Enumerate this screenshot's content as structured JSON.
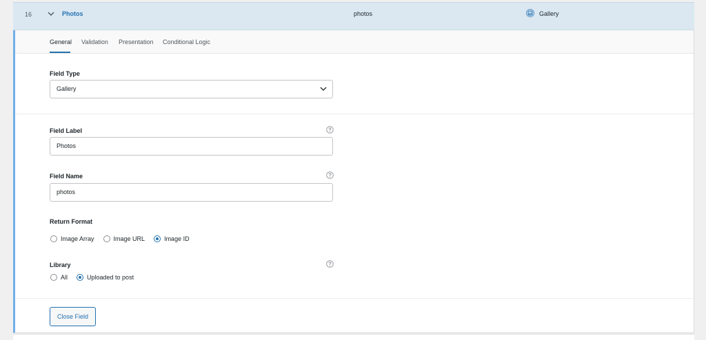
{
  "header": {
    "order": "16",
    "label": "Photos",
    "name": "photos",
    "type": "Gallery",
    "icons": {
      "toggle": "chevron-down-icon",
      "type": "gallery-icon"
    }
  },
  "tabs": [
    {
      "label": "General",
      "active": true
    },
    {
      "label": "Validation",
      "active": false
    },
    {
      "label": "Presentation",
      "active": false
    },
    {
      "label": "Conditional Logic",
      "active": false
    }
  ],
  "field_type": {
    "label": "Field Type",
    "value": "Gallery"
  },
  "field_label": {
    "label": "Field Label",
    "value": "Photos"
  },
  "field_name": {
    "label": "Field Name",
    "value": "photos"
  },
  "return_format": {
    "label": "Return Format",
    "options": [
      "Image Array",
      "Image URL",
      "Image ID"
    ],
    "selected": "Image ID"
  },
  "library": {
    "label": "Library",
    "options": [
      "All",
      "Uploaded to post"
    ],
    "selected": "Uploaded to post"
  },
  "close_button": "Close Field",
  "colors": {
    "accent": "#2271b1",
    "header_bg": "#dbe8f2",
    "panel_border": "#72aee6"
  }
}
